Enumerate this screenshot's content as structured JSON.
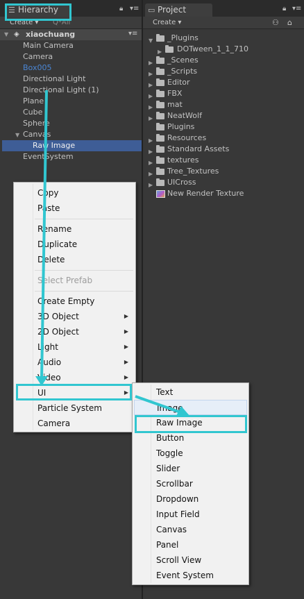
{
  "hierarchy": {
    "tab_label": "Hierarchy",
    "create_label": "Create",
    "search_placeholder": "Q*All",
    "scene_name": "xiaochuang",
    "items": [
      "Main Camera",
      "Camera",
      "Box005",
      "Directional Light",
      "Directional Light (1)",
      "Plane",
      "Cube",
      "Sphere",
      "Canvas",
      "Raw Image",
      "EventSystem"
    ],
    "box_color": "#4a86d4",
    "selection_color": "#3e5d96"
  },
  "project": {
    "tab_label": "Project",
    "create_label": "Create",
    "items": [
      "_Plugins",
      "DOTween_1_1_710",
      "_Scenes",
      "_Scripts",
      "Editor",
      "FBX",
      "mat",
      "NeatWolf",
      "Plugins",
      "Resources",
      "Standard Assets",
      "textures",
      "Tree_Textures",
      "UICross",
      "New Render Texture"
    ]
  },
  "context_menu": {
    "items": [
      "Copy",
      "Paste",
      "Rename",
      "Duplicate",
      "Delete",
      "Select Prefab",
      "Create Empty",
      "3D Object",
      "2D Object",
      "Light",
      "Audio",
      "Video",
      "UI",
      "Particle System",
      "Camera"
    ]
  },
  "ui_submenu": {
    "items": [
      "Text",
      "Image",
      "Raw Image",
      "Button",
      "Toggle",
      "Slider",
      "Scrollbar",
      "Dropdown",
      "Input Field",
      "Canvas",
      "Panel",
      "Scroll View",
      "Event System"
    ]
  },
  "annotation_color": "#31c6d0"
}
